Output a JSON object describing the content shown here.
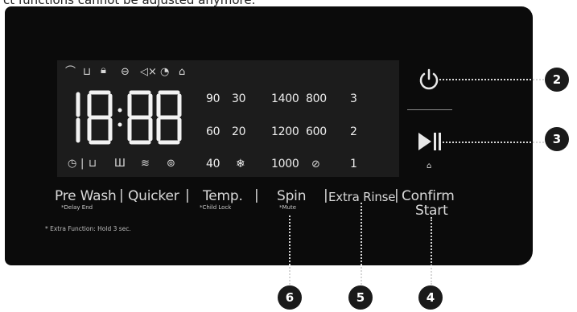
{
  "caption": "ct functions cannot be adjusted anymore.",
  "display": {
    "digits": "18:88",
    "top_icons": [
      "stains-icon",
      "prewash-tub-icon",
      "door-lock-icon",
      "dry-icon",
      "mute-icon",
      "delay-clock-icon",
      "shirt-icon"
    ],
    "bottom_icons": [
      "clock-icon",
      "tub-icon",
      "tub-wide-icon",
      "tub-wave-icon",
      "tub-spin-icon"
    ],
    "temps": [
      [
        "90",
        "30"
      ],
      [
        "60",
        "20"
      ],
      [
        "40",
        "❄"
      ]
    ],
    "spins": [
      [
        "1400",
        "800"
      ],
      [
        "1200",
        "600"
      ],
      [
        "1000",
        "no-spin-icon"
      ]
    ],
    "rinses": [
      "3",
      "2",
      "1"
    ]
  },
  "buttons": {
    "prewash": "Pre Wash",
    "prewash_sub": "*Delay End",
    "quicker": "Quicker",
    "temp": "Temp.",
    "temp_sub": "*Child Lock",
    "spin": "Spin",
    "spin_sub": "*Mute",
    "extra_rinse": "Extra Rinse",
    "confirm": "Confirm",
    "start": "Start",
    "separator": "|"
  },
  "note": "* Extra Function: Hold 3 sec.",
  "callouts": {
    "power": "2",
    "play": "3",
    "confirm": "4",
    "rinse": "5",
    "spin": "6"
  }
}
